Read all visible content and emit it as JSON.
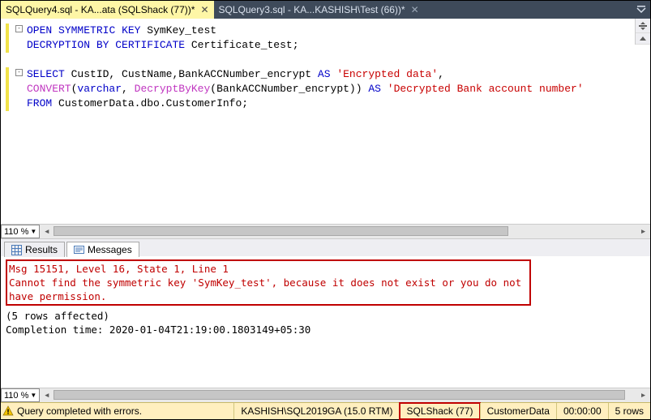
{
  "tabs": {
    "active": {
      "label": "SQLQuery4.sql - KA...ata (SQLShack (77))*"
    },
    "inactive": {
      "label": "SQLQuery3.sql - KA...KASHISH\\Test (66))*"
    }
  },
  "code": {
    "l1a": "OPEN",
    "l1b": "SYMMETRIC",
    "l1c": "KEY",
    "l1d": " SymKey_test",
    "l2a": "DECRYPTION",
    "l2b": "BY",
    "l2c": "CERTIFICATE",
    "l2d": " Certificate_test",
    "semi": ";",
    "l4a": "SELECT",
    "l4b": " CustID",
    "comma": ",",
    "l4c": " CustName",
    "l4d": "BankACCNumber_encrypt ",
    "l4e": "AS",
    "l4f": "'Encrypted data'",
    "l5a": "CONVERT",
    "l5b": "varchar",
    "l5c": "DecryptByKey",
    "l5d": "BankACCNumber_encrypt",
    "l5e": "AS",
    "l5f": "'Decrypted Bank account number'",
    "lp": "(",
    "rp": ")",
    "l6a": "FROM",
    "l6b": " CustomerData",
    "dot": ".",
    "l6c": "dbo",
    "l6d": "CustomerInfo"
  },
  "zoom": {
    "editor": "110 %",
    "messages": "110 %"
  },
  "result_tabs": {
    "results": "Results",
    "messages": "Messages"
  },
  "messages": {
    "err_line1": "Msg 15151, Level 16, State 1, Line 1",
    "err_line2": "Cannot find the symmetric key 'SymKey_test', because it does not exist or you do not have permission.",
    "blank": "",
    "affected": "(5 rows affected)",
    "completion": "Completion time: 2020-01-04T21:19:00.1803149+05:30"
  },
  "status": {
    "text": "Query completed with errors.",
    "server": "KASHISH\\SQL2019GA (15.0 RTM)",
    "user": "SQLShack (77)",
    "db": "CustomerData",
    "time": "00:00:00",
    "rows": "5 rows"
  }
}
